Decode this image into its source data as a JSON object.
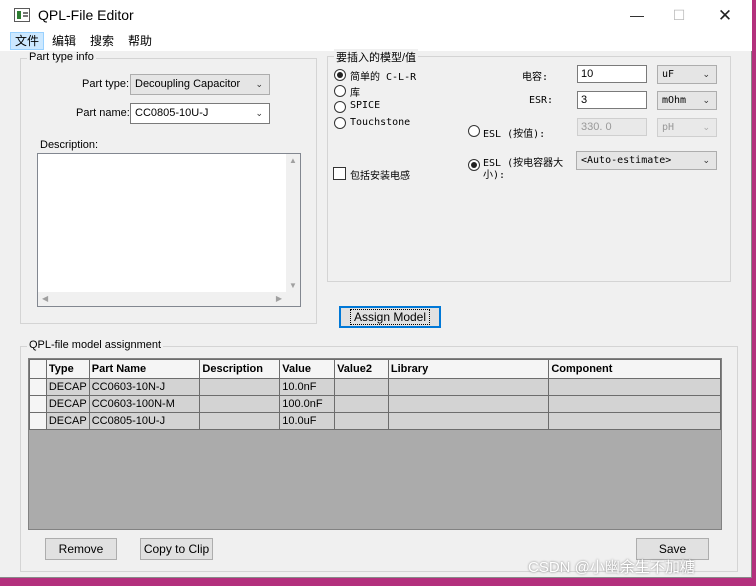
{
  "window": {
    "title": "QPL-File Editor"
  },
  "menu": [
    "文件",
    "编辑",
    "搜索",
    "帮助"
  ],
  "part_info": {
    "group_title": "Part type info",
    "type_label": "Part type:",
    "type_value": "Decoupling Capacitor",
    "name_label": "Part name:",
    "name_value": "CC0805-10U-J",
    "description_label": "Description:",
    "description_value": ""
  },
  "model": {
    "group_title": "要插入的模型/值",
    "options": [
      "简单的 C-L-R",
      "库",
      "SPICE",
      "Touchstone"
    ],
    "selected_option": 0,
    "include_mount_label": "包括安装电感",
    "capacitance_label": "电容:",
    "capacitance_value": "10",
    "capacitance_unit": "uF",
    "esr_label": "ESR:",
    "esr_value": "3",
    "esr_unit": "mOhm",
    "esl_value_label": "ESL (按值):",
    "esl_value": "330. 0",
    "esl_unit": "pH",
    "esl_size_label_1": "ESL (按电容器大",
    "esl_size_label_2": "小):",
    "esl_size_value": "<Auto-estimate>",
    "assign_button": "Assign Model"
  },
  "assignment": {
    "group_title": "QPL-file model assignment",
    "columns": [
      "Type",
      "Part Name",
      "Description",
      "Value",
      "Value2",
      "Library",
      "Component"
    ],
    "rows": [
      [
        "DECAP",
        "CC0603-10N-J",
        "",
        "10.0nF",
        "",
        "",
        ""
      ],
      [
        "DECAP",
        "CC0603-100N-M",
        "",
        "100.0nF",
        "",
        "",
        ""
      ],
      [
        "DECAP",
        "CC0805-10U-J",
        "",
        "10.0uF",
        "",
        "",
        ""
      ]
    ]
  },
  "buttons": {
    "remove": "Remove",
    "copy": "Copy to Clip",
    "save": "Save"
  },
  "watermark": "CSDN @小幽余生不加糖"
}
